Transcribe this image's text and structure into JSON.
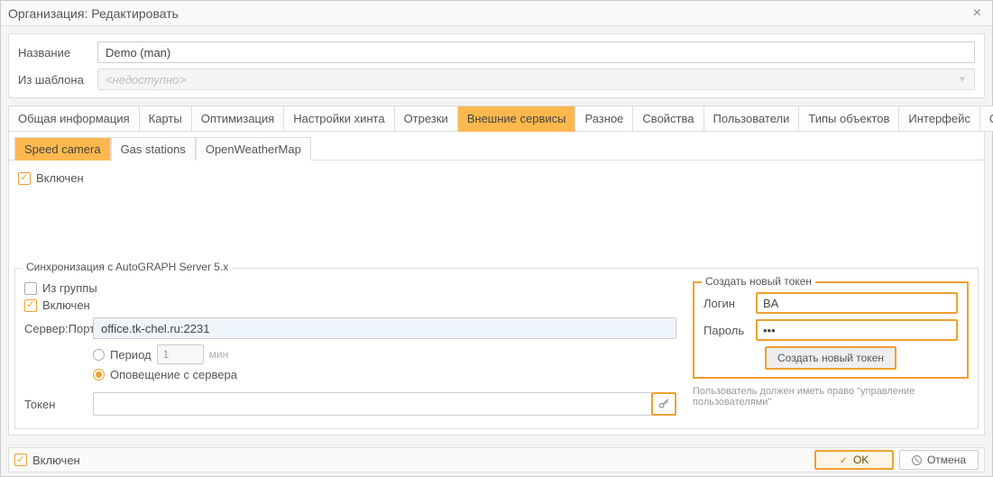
{
  "window": {
    "title": "Организация: Редактировать"
  },
  "form": {
    "name_label": "Название",
    "name_value": "Demo (man)",
    "template_label": "Из шаблона",
    "template_placeholder": "<недоступно>"
  },
  "tabs": [
    {
      "label": "Общая информация"
    },
    {
      "label": "Карты"
    },
    {
      "label": "Оптимизация"
    },
    {
      "label": "Настройки хинта"
    },
    {
      "label": "Отрезки"
    },
    {
      "label": "Внешние сервисы",
      "active": true
    },
    {
      "label": "Разное"
    },
    {
      "label": "Свойства"
    },
    {
      "label": "Пользователи"
    },
    {
      "label": "Типы объектов"
    },
    {
      "label": "Интерфейс"
    },
    {
      "label": "Счётчики пробега и моточасов"
    }
  ],
  "subtabs": [
    {
      "label": "Speed camera",
      "active": true
    },
    {
      "label": "Gas stations"
    },
    {
      "label": "OpenWeatherMap"
    }
  ],
  "speedcamera": {
    "enabled_label": "Включен",
    "enabled": true
  },
  "sync": {
    "legend": "Синхронизация c AutoGRAPH Server 5.x",
    "from_group_label": "Из группы",
    "from_group": false,
    "enabled_label": "Включен",
    "enabled": true,
    "server_label": "Сервер:Порт",
    "server_value": "office.tk-chel.ru:2231",
    "period_label": "Период",
    "period_value": "1",
    "period_unit": "мин",
    "notify_label": "Оповещение с сервера",
    "mode": "notify",
    "token_label": "Токен",
    "token_value": ""
  },
  "new_token": {
    "legend": "Создать новый токен",
    "login_label": "Логин",
    "login_value": "BA",
    "password_label": "Пароль",
    "password_value": "•••",
    "button_label": "Создать новый токен",
    "hint": "Пользователь должен иметь право \"управление пользователями\""
  },
  "footer": {
    "enabled_label": "Включен",
    "enabled": true,
    "ok_label": "OK",
    "cancel_label": "Отмена"
  }
}
